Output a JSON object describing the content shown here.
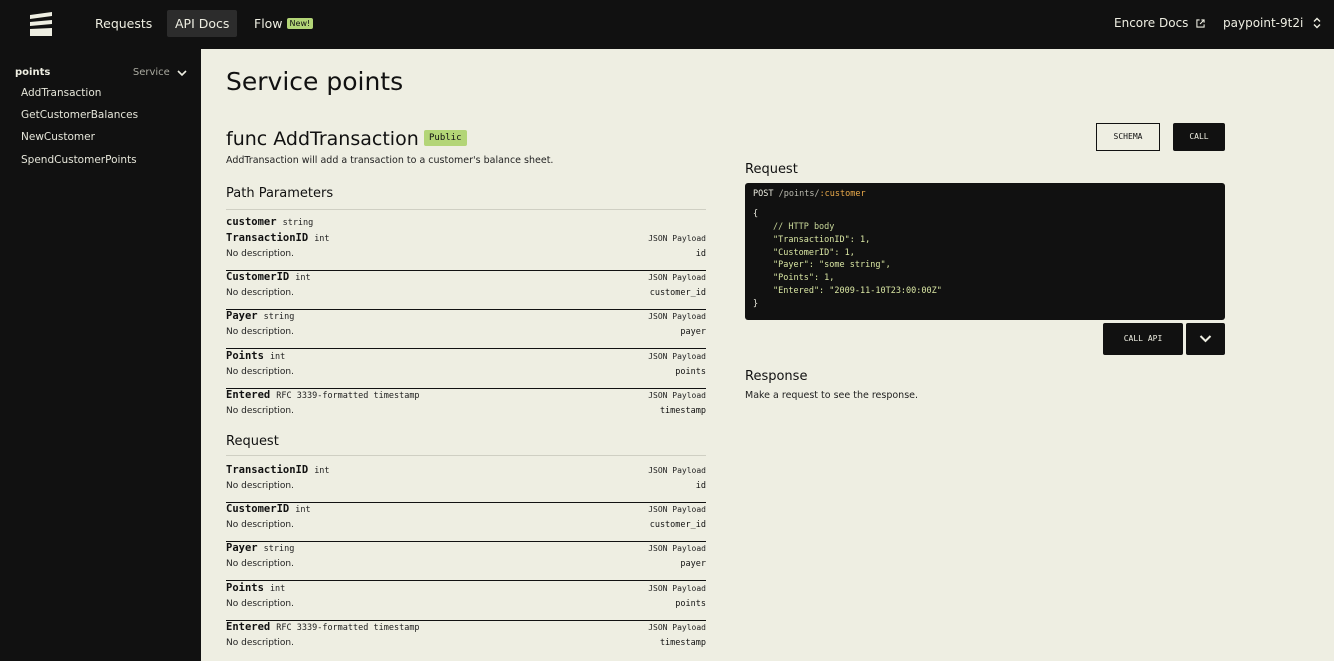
{
  "topbar": {
    "nav": [
      {
        "label": "Requests"
      },
      {
        "label": "API Docs",
        "active": true
      },
      {
        "label": "Flow",
        "badge": "New!"
      }
    ],
    "docs_link": "Encore Docs",
    "app_selector": "paypoint-9t2i"
  },
  "sidebar": {
    "service": "points",
    "kind": "Service",
    "items": [
      "AddTransaction",
      "GetCustomerBalances",
      "NewCustomer",
      "SpendCustomerPoints"
    ]
  },
  "main": {
    "page_title": "Service points",
    "func_title": "func AddTransaction",
    "visibility": "Public",
    "description": "AddTransaction will add a transaction to a customer's balance sheet.",
    "schema_button": "SCHEMA",
    "call_button": "CALL",
    "path_params_title": "Path Parameters",
    "path_param": {
      "name": "customer",
      "type": "string"
    },
    "path_body_params": [
      {
        "name": "TransactionID",
        "type": "int",
        "location": "JSON Payload",
        "desc": "No description.",
        "field": "id"
      },
      {
        "name": "CustomerID",
        "type": "int",
        "location": "JSON Payload",
        "desc": "No description.",
        "field": "customer_id"
      },
      {
        "name": "Payer",
        "type": "string",
        "location": "JSON Payload",
        "desc": "No description.",
        "field": "payer"
      },
      {
        "name": "Points",
        "type": "int",
        "location": "JSON Payload",
        "desc": "No description.",
        "field": "points"
      },
      {
        "name": "Entered",
        "type": "RFC 3339-formatted timestamp",
        "location": "JSON Payload",
        "desc": "No description.",
        "field": "timestamp"
      }
    ],
    "request_title": "Request",
    "request_params": [
      {
        "name": "TransactionID",
        "type": "int",
        "location": "JSON Payload",
        "desc": "No description.",
        "field": "id"
      },
      {
        "name": "CustomerID",
        "type": "int",
        "location": "JSON Payload",
        "desc": "No description.",
        "field": "customer_id"
      },
      {
        "name": "Payer",
        "type": "string",
        "location": "JSON Payload",
        "desc": "No description.",
        "field": "payer"
      },
      {
        "name": "Points",
        "type": "int",
        "location": "JSON Payload",
        "desc": "No description.",
        "field": "points"
      },
      {
        "name": "Entered",
        "type": "RFC 3339-formatted timestamp",
        "location": "JSON Payload",
        "desc": "No description.",
        "field": "timestamp"
      }
    ]
  },
  "request_panel": {
    "title": "Request",
    "method": "POST",
    "path": "/points/",
    "path_param": ":customer",
    "open_brace": "{",
    "comment": "// HTTP body",
    "body_lines": [
      "\"TransactionID\": 1,",
      "\"CustomerID\": 1,",
      "\"Payer\": \"some string\",",
      "\"Points\": 1,",
      "\"Entered\": \"2009-11-10T23:00:00Z\""
    ],
    "close_brace": "}",
    "call_api_button": "CALL API",
    "response_title": "Response",
    "response_text": "Make a request to see the response."
  },
  "colors": {
    "background": "#eeeee2",
    "dark": "#111111",
    "badge": "#b3d577",
    "path_param": "#e9a94a",
    "code_body": "#d9e6a3"
  }
}
